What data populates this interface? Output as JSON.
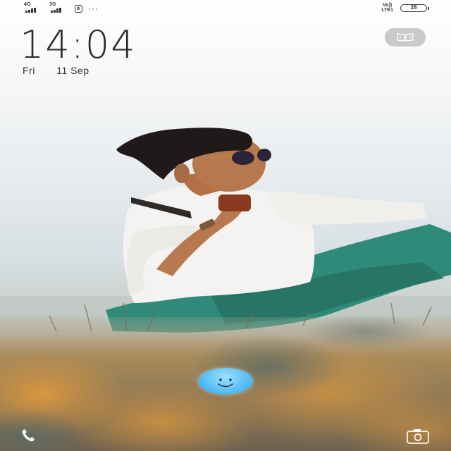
{
  "status_bar": {
    "sim1_network": "4G",
    "sim2_network": "3G",
    "more_indicator": "···",
    "volte_label_top": "Vo))",
    "volte_label_bottom": "LTE1",
    "battery_level": "28",
    "icons": [
      "signal-icon",
      "signal-icon",
      "instagram-icon",
      "more-icon",
      "volte-icon",
      "battery-icon"
    ]
  },
  "lockscreen": {
    "time": "14:04",
    "date_day": "Fri",
    "date_text": "11 Sep"
  },
  "shortcuts": {
    "left": "phone-icon",
    "center": "smiley-icon",
    "right": "camera-icon",
    "top_right": "book-icon"
  },
  "colors": {
    "text": "#2b2b2b",
    "smiley": "#5cbff5",
    "pill": "#a0a0a0"
  }
}
